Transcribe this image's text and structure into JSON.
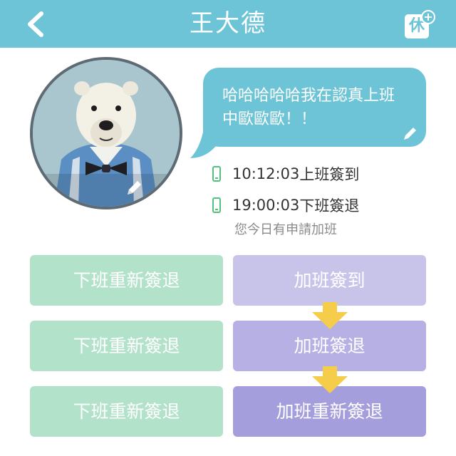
{
  "header": {
    "title": "王大德",
    "leave_label": "休",
    "back_icon": "chevron-left-icon",
    "leave_icon": "leave-plus-icon",
    "bg_color": "#6cc4d6"
  },
  "status": {
    "message": "哈哈哈哈哈我在認真上班中歐歐歐！！"
  },
  "records": [
    {
      "time": "10:12:03",
      "label": "上班簽到",
      "icon": "phone-icon"
    },
    {
      "time": "19:00:03",
      "label": "下班簽退",
      "icon": "phone-icon"
    }
  ],
  "overtime_note": "您今日有申請加班",
  "actions": {
    "left": [
      {
        "label": "下班重新簽退"
      },
      {
        "label": "下班重新簽退"
      },
      {
        "label": "下班重新簽退"
      }
    ],
    "right": [
      {
        "label": "加班簽到",
        "color": "#c8c4e9"
      },
      {
        "label": "加班簽退",
        "color": "#b6b0e5"
      },
      {
        "label": "加班重新簽退",
        "color": "#a59edd"
      }
    ],
    "green_color": "#b3e2cb",
    "arrow_color": "#f5cd4a"
  }
}
